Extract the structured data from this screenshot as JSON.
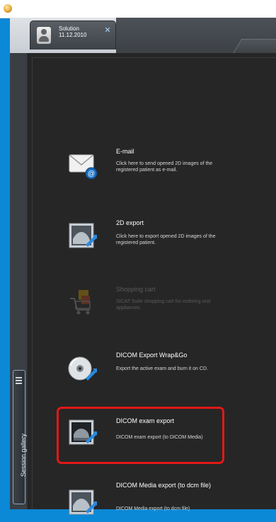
{
  "session": {
    "title": "Solution",
    "date": "11.12.2010"
  },
  "sidebar": {
    "gallery_label": "Session gallery"
  },
  "items": [
    {
      "title": "E-mail",
      "description": "Click here to send opened 2D images of the registered patient as e-mail.",
      "icon": "email-icon",
      "enabled": true
    },
    {
      "title": "2D export",
      "description": "Click here to export opened 2D images of the registered patient.",
      "icon": "2d-export-icon",
      "enabled": true
    },
    {
      "title": "Shopping cart",
      "description": "SICAT Suite shopping cart for ordering oral appliances.",
      "icon": "shopping-cart-icon",
      "enabled": false
    },
    {
      "title": "DICOM Export Wrap&Go",
      "description": "Export the active exam and burn it on CD.",
      "icon": "cd-export-icon",
      "enabled": true
    },
    {
      "title": "DICOM exam export",
      "description": "DICOM exam export (to DICOM Media)",
      "icon": "dicom-exam-export-icon",
      "enabled": true
    },
    {
      "title": "DICOM Media export  (to dcm file)",
      "description": "DICOM Media export  (to dcm file)",
      "icon": "dicom-media-export-icon",
      "enabled": true
    }
  ]
}
